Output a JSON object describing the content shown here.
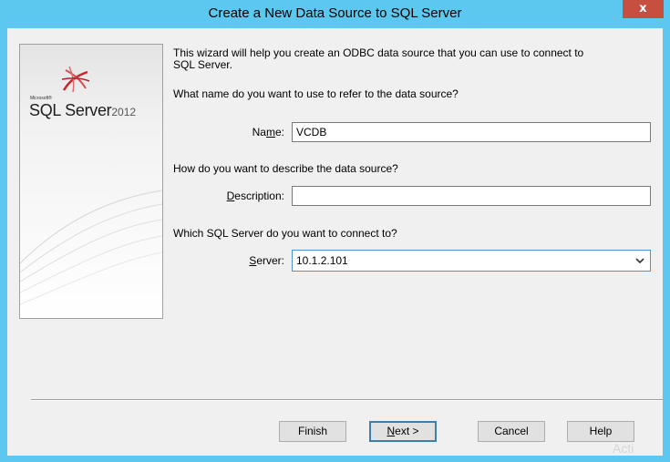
{
  "window": {
    "title": "Create a New Data Source to SQL Server",
    "close_label": "x"
  },
  "banner": {
    "brand_small": "Microsoft®",
    "brand_name": "SQL Server",
    "brand_year": "2012"
  },
  "wizard": {
    "intro_line1": "This wizard will help you create an ODBC data source that you can use to connect to",
    "intro_line2": "SQL Server.",
    "name_prompt": "What name do you want to use to refer to the data source?",
    "name_label_pre": "Na",
    "name_label_key": "m",
    "name_label_post": "e:",
    "name_value": "VCDB",
    "description_prompt": "How do you want to describe the data source?",
    "description_label_key": "D",
    "description_label_post": "escription:",
    "description_value": "",
    "server_prompt": "Which SQL Server do you want to connect to?",
    "server_label_key": "S",
    "server_label_post": "erver:",
    "server_value": "10.1.2.101"
  },
  "buttons": {
    "finish": "Finish",
    "next_key": "N",
    "next_rest": "ext >",
    "cancel": "Cancel",
    "help": "Help"
  },
  "watermark": "Acti",
  "colors": {
    "titlebar": "#5cc8ef",
    "close": "#c74f40",
    "client": "#f0f0f0"
  },
  "icons": {
    "logo": "sql-server-logo-icon",
    "dropdown": "chevron-down-icon"
  }
}
